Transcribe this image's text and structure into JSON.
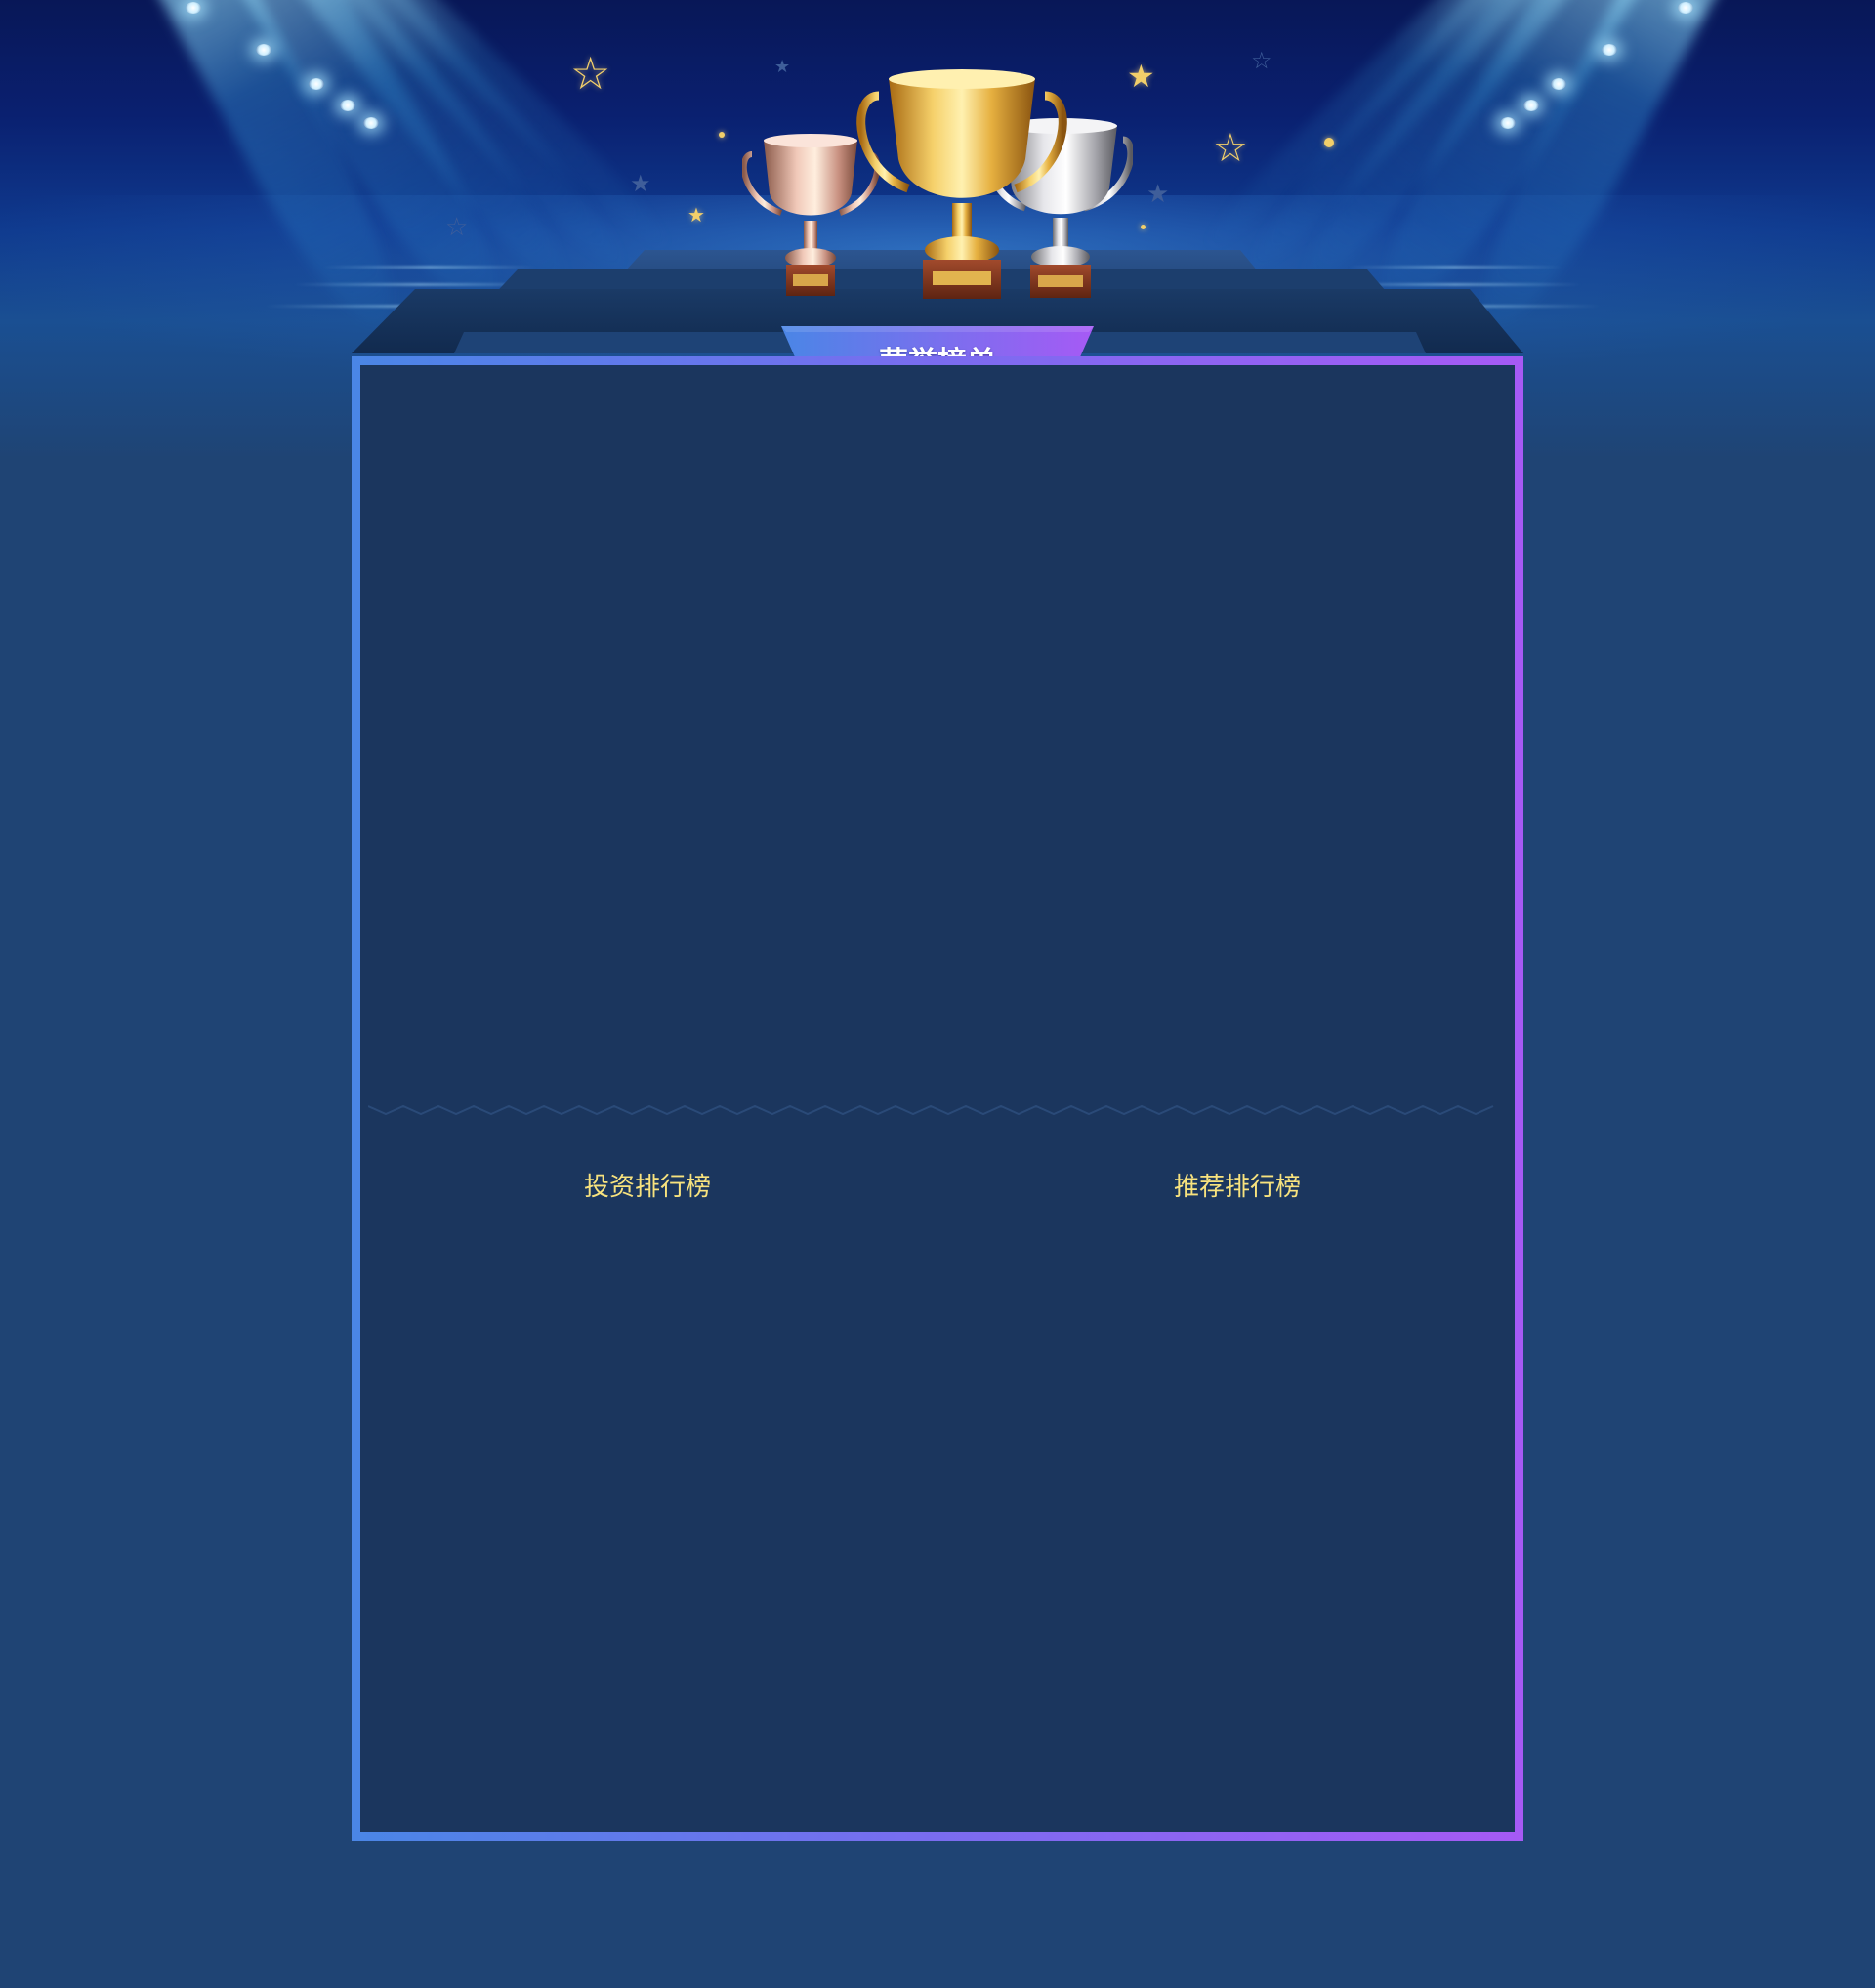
{
  "banner": {
    "title": "荣誉榜单"
  },
  "boards": {
    "investment_label": "投资排行榜",
    "referral_label": "推荐排行榜"
  },
  "decor": {
    "trophy_icons": [
      "bronze-trophy-icon",
      "gold-trophy-icon",
      "silver-trophy-icon"
    ],
    "star_icon": "star-icon",
    "spotlight_icon": "spotlight-icon"
  },
  "colors": {
    "page_background": "#1f4474",
    "panel_background": "#1b365e",
    "border_gradient_start": "#4a86e6",
    "border_gradient_end": "#a65af5",
    "label_color": "#f7e27e",
    "banner_text": "#ffffff"
  }
}
